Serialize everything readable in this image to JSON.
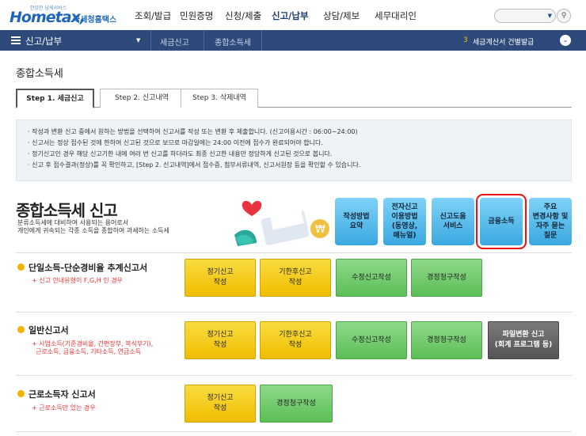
{
  "header": {
    "logo_small": "안녕한 납세서비스",
    "logo_main": "Hometax,",
    "logo_kr": "국세청홈택스",
    "nav": [
      "조회/발급",
      "민원증명",
      "신청/제출",
      "신고/납부",
      "상담/제보",
      "세무대리인"
    ]
  },
  "subbar": {
    "section": "신고/납부",
    "crumb1": "세금신고",
    "crumb2": "종합소득세",
    "notice_num": "3",
    "notice": "세금계산서 건별발급"
  },
  "page": {
    "title": "종합소득세"
  },
  "tabs": [
    "Step 1. 세금신고",
    "Step 2. 신고내역",
    "Step 3. 삭제내역"
  ],
  "info": [
    "작성과 변환 신고 중에서 원하는 방법을 선택하여 신고서를 작성 또는 변환 후 제출합니다. (신고이용시간 : 06:00~24:00)",
    "신고서는 정상 접수된 것에 한하여 신고된 것으로 보므로 마감일에는 24:00 이전에 접수가 완료되어야 합니다.",
    "정기신고인 경우 해당 신고기한 내에 여러 번 신고를 하더라도 최종 신고한 내용만 정당하게 신고된 것으로 봅니다.",
    "신고 후 접수결과(정상)를 꼭 확인하고, [Step 2. 신고내역]에서 접수증, 첨부서류내역, 신고서원장 등을 확인할 수 있습니다."
  ],
  "banner": {
    "title": "종합소득세 신고",
    "desc1": "분류소득세에 대비하여 사용되는 용어로서",
    "desc2": "개인에게 귀속되는 각종 소득을 종합하여 과세하는 소득세",
    "buttons": [
      "작성방법\n요약",
      "전자신고\n이용방법\n(동영상,\n매뉴얼)",
      "신고도움\n서비스",
      "금융소득",
      "주요\n변경사항 및\n자주 묻는\n질문"
    ]
  },
  "rows": [
    {
      "title": "단일소득-단순경비율 추계신고서",
      "note": "+ 신고 안내유형이 F,G,H 인 경우",
      "buttons": [
        "정기신고\n작성",
        "기한후신고\n작성",
        "수정신고작성",
        "경정청구작성"
      ]
    },
    {
      "title": "일반신고서",
      "note": "+ 사업소득(기준경비율, 간편장부, 복식부기),\n  근로소득, 금융소득, 기타소득, 연금소득",
      "buttons": [
        "정기신고\n작성",
        "기한후신고\n작성",
        "수정신고작성",
        "경정청구작성",
        "파일변환 신고\n(회계 프로그램 등)"
      ]
    },
    {
      "title": "근로소득자 신고서",
      "note": "+ 근로소득만 있는 경우",
      "buttons": [
        "정기신고\n작성",
        "경정청구작성"
      ]
    }
  ]
}
